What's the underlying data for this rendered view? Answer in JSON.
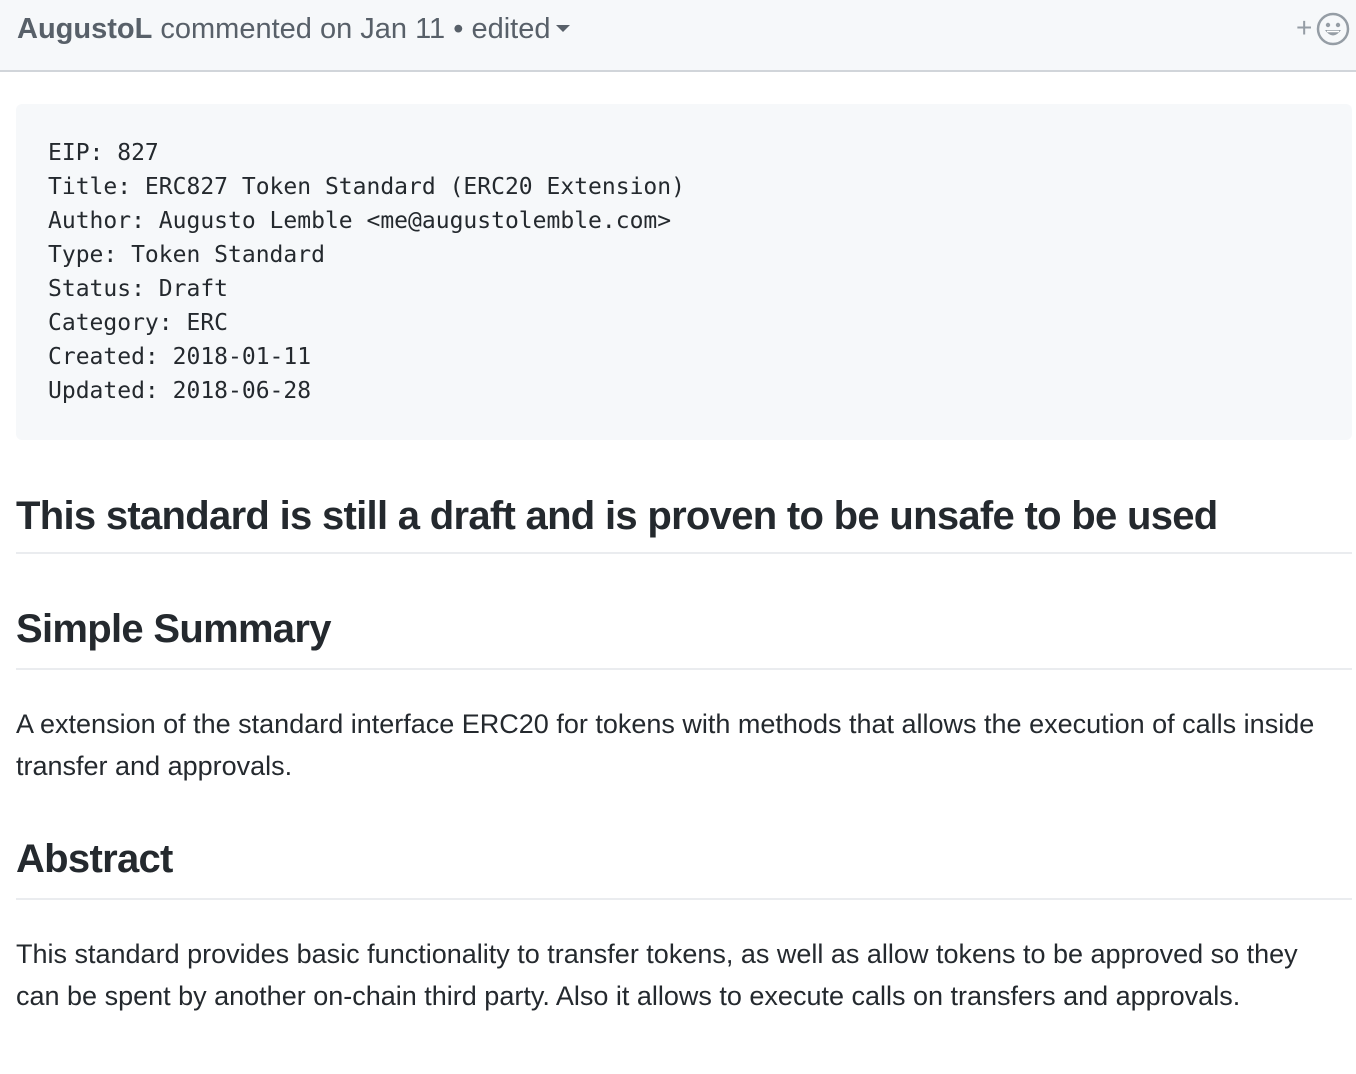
{
  "comment_header": {
    "author": "AugustoL",
    "action": "commented on Jan 11",
    "separator": "•",
    "edited_label": "edited",
    "reaction_plus": "+",
    "reaction_icon": "smiley-icon"
  },
  "code_block": {
    "lines": [
      "EIP: 827",
      "Title: ERC827 Token Standard (ERC20 Extension)",
      "Author: Augusto Lemble <me@augustolemble.com>",
      "Type: Token Standard",
      "Status: Draft",
      "Category: ERC",
      "Created: 2018-01-11",
      "Updated: 2018-06-28"
    ]
  },
  "body": {
    "warning_heading": "This standard is still a draft and is proven to be unsafe to be used",
    "summary_heading": "Simple Summary",
    "summary_text": "A extension of the standard interface ERC20 for tokens with methods that allows the execution of calls inside transfer and approvals.",
    "abstract_heading": "Abstract",
    "abstract_text": "This standard provides basic functionality to transfer tokens, as well as allow tokens to be approved so they can be spent by another on-chain third party. Also it allows to execute calls on transfers and approvals."
  },
  "colors": {
    "header_bg": "#f6f8fa",
    "header_text": "#586069",
    "body_text": "#24292e",
    "code_bg": "#f6f8fa",
    "rule": "#eaecef"
  }
}
